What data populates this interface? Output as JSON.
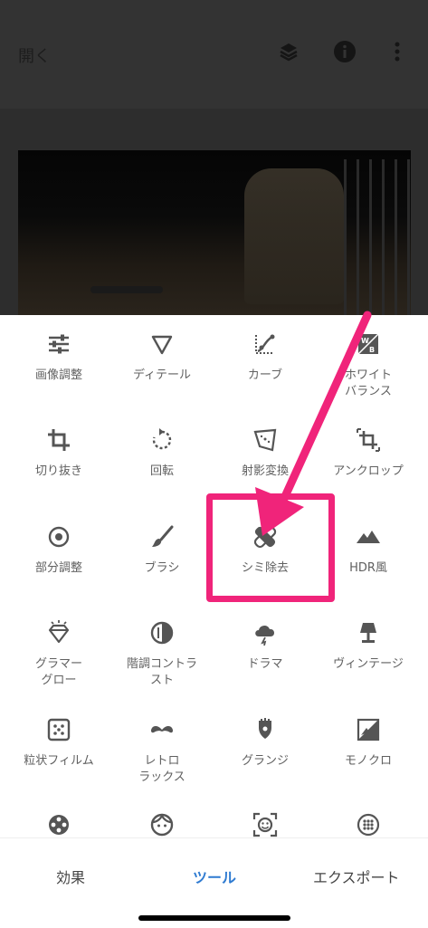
{
  "header": {
    "open_label": "開く"
  },
  "tools": [
    {
      "label": "画像調整",
      "icon": "sliders-icon"
    },
    {
      "label": "ディテール",
      "icon": "triangle-icon"
    },
    {
      "label": "カーブ",
      "icon": "curve-icon"
    },
    {
      "label": "ホワイト\nバランス",
      "icon": "white-balance-icon"
    },
    {
      "label": "切り抜き",
      "icon": "crop-icon"
    },
    {
      "label": "回転",
      "icon": "rotate-icon"
    },
    {
      "label": "射影変換",
      "icon": "perspective-icon"
    },
    {
      "label": "アンクロップ",
      "icon": "expand-icon"
    },
    {
      "label": "部分調整",
      "icon": "selective-icon"
    },
    {
      "label": "ブラシ",
      "icon": "brush-icon"
    },
    {
      "label": "シミ除去",
      "icon": "healing-icon"
    },
    {
      "label": "HDR風",
      "icon": "mountain-icon"
    },
    {
      "label": "グラマー\nグロー",
      "icon": "diamond-icon"
    },
    {
      "label": "階調コントラ\nスト",
      "icon": "tonal-contrast-icon"
    },
    {
      "label": "ドラマ",
      "icon": "cloud-icon"
    },
    {
      "label": "ヴィンテージ",
      "icon": "lamp-icon"
    },
    {
      "label": "粒状フィルム",
      "icon": "grain-icon"
    },
    {
      "label": "レトロ\nラックス",
      "icon": "mustache-icon"
    },
    {
      "label": "グランジ",
      "icon": "guitar-icon"
    },
    {
      "label": "モノクロ",
      "icon": "monochrome-icon"
    },
    {
      "label": "",
      "icon": "film-reel-icon"
    },
    {
      "label": "",
      "icon": "face-icon"
    },
    {
      "label": "",
      "icon": "face-detect-icon"
    },
    {
      "label": "",
      "icon": "dots-circle-icon"
    }
  ],
  "bottom_tabs": [
    {
      "label": "効果",
      "active": false
    },
    {
      "label": "ツール",
      "active": true
    },
    {
      "label": "エクスポート",
      "active": false
    }
  ],
  "colors": {
    "accent": "#2f7bd1",
    "annotation": "#f0247a",
    "icon": "#555555"
  }
}
